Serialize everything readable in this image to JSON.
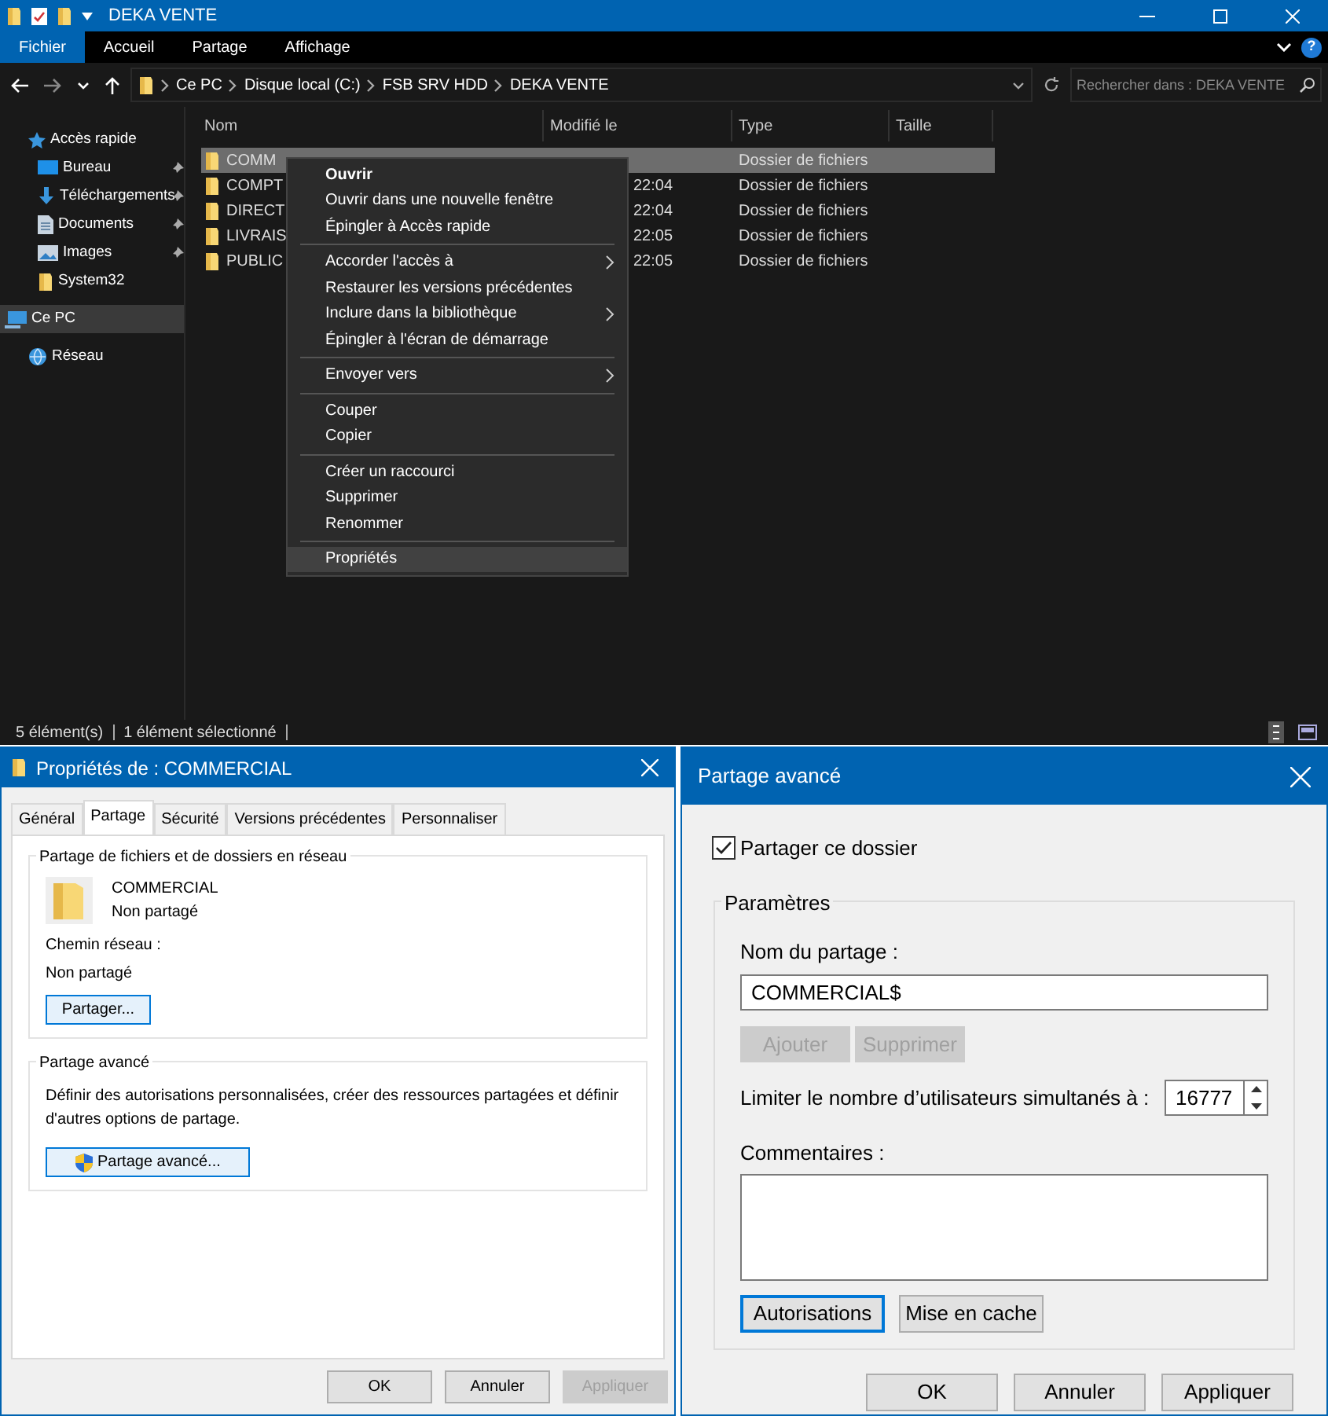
{
  "explorer": {
    "title": "DEKA VENTE",
    "ribbon_tabs": [
      {
        "label": "Fichier",
        "selected": true
      },
      {
        "label": "Accueil",
        "selected": false
      },
      {
        "label": "Partage",
        "selected": false
      },
      {
        "label": "Affichage",
        "selected": false
      }
    ],
    "help": "?",
    "breadcrumb": [
      "Ce PC",
      "Disque local (C:)",
      "FSB SRV HDD",
      "DEKA VENTE"
    ],
    "search": {
      "placeholder": "Rechercher dans : DEKA VENTE"
    },
    "nav": [
      {
        "label": "Accès rapide",
        "kind": "star",
        "pinned": false,
        "selected": false,
        "children": [
          {
            "label": "Bureau",
            "kind": "desktop",
            "pinned": true,
            "selected": false
          },
          {
            "label": "Téléchargements",
            "kind": "download",
            "pinned": true,
            "selected": false
          },
          {
            "label": "Documents",
            "kind": "document",
            "pinned": true,
            "selected": false
          },
          {
            "label": "Images",
            "kind": "image",
            "pinned": true,
            "selected": false
          },
          {
            "label": "System32",
            "kind": "folder",
            "pinned": false,
            "selected": false
          }
        ]
      },
      {
        "label": "Ce PC",
        "kind": "pc",
        "pinned": false,
        "selected": true
      },
      {
        "label": "Réseau",
        "kind": "network",
        "pinned": false,
        "selected": false
      }
    ],
    "columns": [
      "Nom",
      "Modifié le",
      "Type",
      "Taille"
    ],
    "rows": [
      {
        "name": "COMM",
        "type": "Dossier de fichiers",
        "selected": true
      },
      {
        "name": "COMPT",
        "date": "22:04",
        "type": "Dossier de fichiers",
        "selected": false
      },
      {
        "name": "DIRECT",
        "date": "22:04",
        "type": "Dossier de fichiers",
        "selected": false
      },
      {
        "name": "LIVRAIS",
        "date": "22:05",
        "type": "Dossier de fichiers",
        "selected": false
      },
      {
        "name": "PUBLIC",
        "date": "22:05",
        "type": "Dossier de fichiers",
        "selected": false
      }
    ],
    "context_menu": [
      [
        {
          "label": "Ouvrir",
          "bold": true,
          "submenu": false,
          "selected": false
        },
        {
          "label": "Ouvrir dans une nouvelle fenêtre",
          "bold": false,
          "submenu": false,
          "selected": false
        },
        {
          "label": "Épingler à Accès rapide",
          "bold": false,
          "submenu": false,
          "selected": false
        }
      ],
      [
        {
          "label": "Accorder l'accès à",
          "bold": false,
          "submenu": true,
          "selected": false
        },
        {
          "label": "Restaurer les versions précédentes",
          "bold": false,
          "submenu": false,
          "selected": false
        },
        {
          "label": "Inclure dans la bibliothèque",
          "bold": false,
          "submenu": true,
          "selected": false
        },
        {
          "label": "Épingler à l'écran de démarrage",
          "bold": false,
          "submenu": false,
          "selected": false
        }
      ],
      [
        {
          "label": "Envoyer vers",
          "bold": false,
          "submenu": true,
          "selected": false
        }
      ],
      [
        {
          "label": "Couper",
          "bold": false,
          "submenu": false,
          "selected": false
        },
        {
          "label": "Copier",
          "bold": false,
          "submenu": false,
          "selected": false
        }
      ],
      [
        {
          "label": "Créer un raccourci",
          "bold": false,
          "submenu": false,
          "selected": false
        },
        {
          "label": "Supprimer",
          "bold": false,
          "submenu": false,
          "selected": false
        },
        {
          "label": "Renommer",
          "bold": false,
          "submenu": false,
          "selected": false
        }
      ],
      [
        {
          "label": "Propriétés",
          "bold": false,
          "submenu": false,
          "selected": true
        }
      ]
    ],
    "status": [
      "5 élément(s)",
      "1 élément sélectionné"
    ]
  },
  "properties": {
    "title": "Propriétés de : COMMERCIAL",
    "tabs": [
      {
        "label": "Général",
        "selected": false
      },
      {
        "label": "Partage",
        "selected": true
      },
      {
        "label": "Sécurité",
        "selected": false
      },
      {
        "label": "Versions précédentes",
        "selected": false
      },
      {
        "label": "Personnaliser",
        "selected": false
      }
    ],
    "network_group": {
      "legend": "Partage de fichiers et de dossiers en réseau",
      "folder_name": "COMMERCIAL",
      "folder_status": "Non partagé",
      "path_label": "Chemin réseau :",
      "path_value": "Non partagé",
      "button": "Partager..."
    },
    "advanced_group": {
      "legend": "Partage avancé",
      "description": "Définir des autorisations personnalisées, créer des ressources partagées et définir d'autres options de partage.",
      "button": "Partage avancé..."
    },
    "buttons": [
      {
        "label": "OK",
        "disabled": false
      },
      {
        "label": "Annuler",
        "disabled": false
      },
      {
        "label": "Appliquer",
        "disabled": true
      }
    ]
  },
  "advanced": {
    "title": "Partage avancé",
    "share_checkbox": {
      "label": "Partager ce dossier",
      "checked": true
    },
    "legend": "Paramètres",
    "name_label": "Nom du partage :",
    "name_value": "COMMERCIAL$",
    "name_buttons": [
      {
        "label": "Ajouter",
        "disabled": true
      },
      {
        "label": "Supprimer",
        "disabled": true
      }
    ],
    "limit_label": "Limiter le nombre d’utilisateurs simultanés à :",
    "limit_value": "16777",
    "comments_label": "Commentaires :",
    "action_buttons": [
      {
        "label": "Autorisations",
        "focused": true
      },
      {
        "label": "Mise en cache",
        "focused": false
      }
    ],
    "buttons": [
      {
        "label": "OK",
        "disabled": false
      },
      {
        "label": "Annuler",
        "disabled": false
      },
      {
        "label": "Appliquer",
        "disabled": false
      }
    ]
  }
}
